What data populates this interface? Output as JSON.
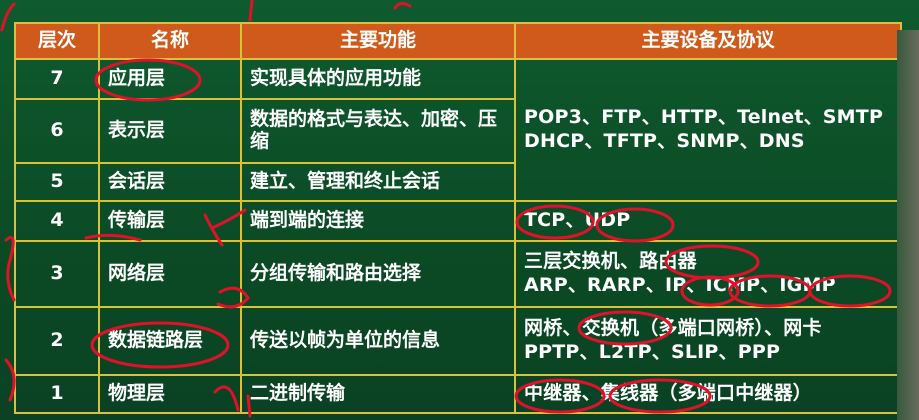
{
  "table": {
    "headers": [
      "层次",
      "名称",
      "主要功能",
      "主要设备及协议"
    ],
    "rows": [
      {
        "level": "7",
        "name": "应用层",
        "function": "实现具体的应用功能"
      },
      {
        "level": "6",
        "name": "表示层",
        "function": "数据的格式与表达、加密、压缩"
      },
      {
        "level": "5",
        "name": "会话层",
        "function": "建立、管理和终止会话"
      },
      {
        "level": "4",
        "name": "传输层",
        "function": "端到端的连接"
      },
      {
        "level": "3",
        "name": "网络层",
        "function": "分组传输和路由选择"
      },
      {
        "level": "2",
        "name": "数据链路层",
        "function": "传送以帧为单位的信息"
      },
      {
        "level": "1",
        "name": "物理层",
        "function": "二进制传输"
      }
    ],
    "protocols_upper": {
      "line1": "POP3、FTP、HTTP、Telnet、SMTP",
      "line2": "DHCP、TFTP、SNMP、DNS"
    },
    "protocols_transport": "TCP、UDP",
    "protocols_network": {
      "line1": "三层交换机、路由器",
      "line2": "ARP、RARP、IP、ICMP、IGMP"
    },
    "protocols_datalink": {
      "line1": "网桥、交换机（多端口网桥）、网卡",
      "line2": "PPTP、L2TP、SLIP、PPP"
    },
    "protocols_physical": "中继器、集线器（多端口中继器）"
  },
  "colors": {
    "board": "#0d4a26",
    "header_bg": "#cf5a1b",
    "grid_line": "#d9c23a",
    "annotation": "#e0122a"
  }
}
